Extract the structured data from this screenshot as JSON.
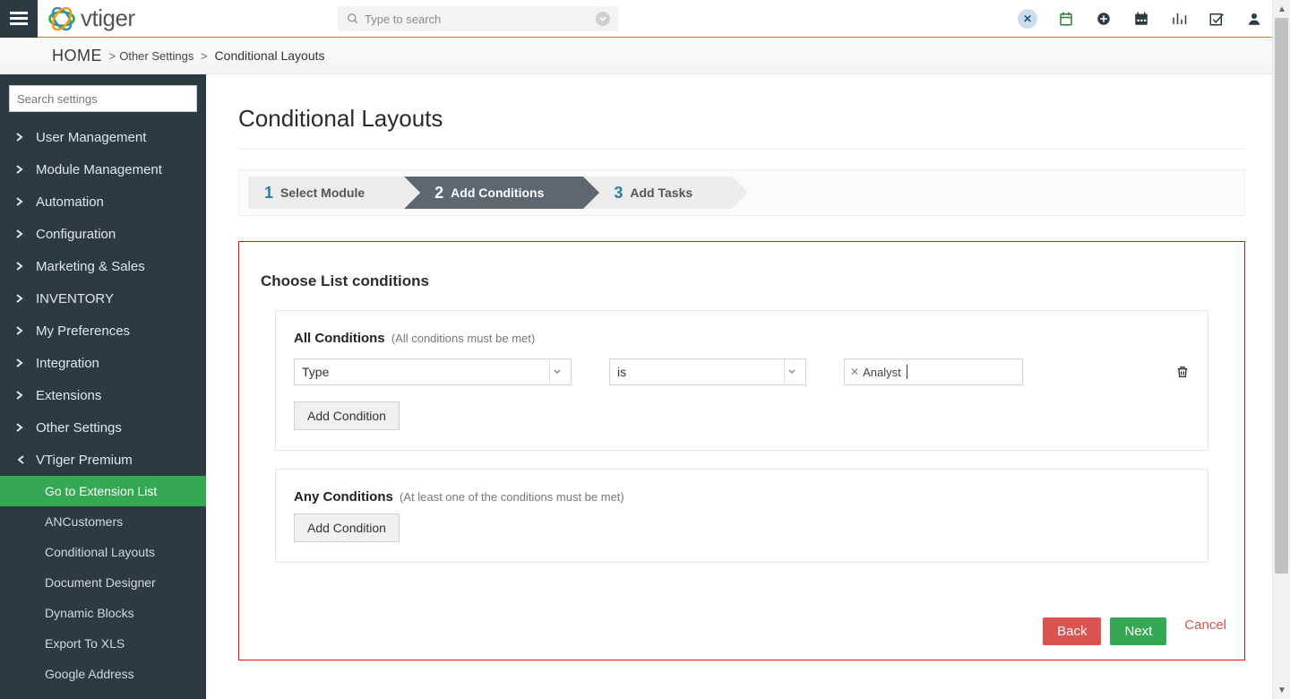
{
  "header": {
    "search_placeholder": "Type to search",
    "logo_text": "vtiger"
  },
  "breadcrumb": {
    "home": "HOME",
    "crumb1": "Other Settings",
    "crumb2": "Conditional Layouts"
  },
  "sidebar": {
    "search_placeholder": "Search settings",
    "items": [
      {
        "label": "User Management"
      },
      {
        "label": "Module Management"
      },
      {
        "label": "Automation"
      },
      {
        "label": "Configuration"
      },
      {
        "label": "Marketing & Sales"
      },
      {
        "label": "INVENTORY"
      },
      {
        "label": "My Preferences"
      },
      {
        "label": "Integration"
      },
      {
        "label": "Extensions"
      },
      {
        "label": "Other Settings"
      },
      {
        "label": "VTiger Premium"
      }
    ],
    "sub_items": [
      {
        "label": "Go to Extension List"
      },
      {
        "label": "ANCustomers"
      },
      {
        "label": "Conditional Layouts"
      },
      {
        "label": "Document Designer"
      },
      {
        "label": "Dynamic Blocks"
      },
      {
        "label": "Export To XLS"
      },
      {
        "label": "Google Address"
      }
    ]
  },
  "content": {
    "title": "Conditional Layouts",
    "steps": [
      {
        "num": "1",
        "label": "Select Module"
      },
      {
        "num": "2",
        "label": "Add Conditions"
      },
      {
        "num": "3",
        "label": "Add Tasks"
      }
    ],
    "panel_heading": "Choose List conditions",
    "all_cond": {
      "title": "All Conditions",
      "hint": "(All conditions must be met)",
      "field": "Type",
      "operator": "is",
      "value_tag": "Analyst",
      "add_btn": "Add Condition"
    },
    "any_cond": {
      "title": "Any Conditions",
      "hint": "(At least one of the conditions must be met)",
      "add_btn": "Add Condition"
    },
    "buttons": {
      "back": "Back",
      "next": "Next",
      "cancel": "Cancel"
    }
  }
}
